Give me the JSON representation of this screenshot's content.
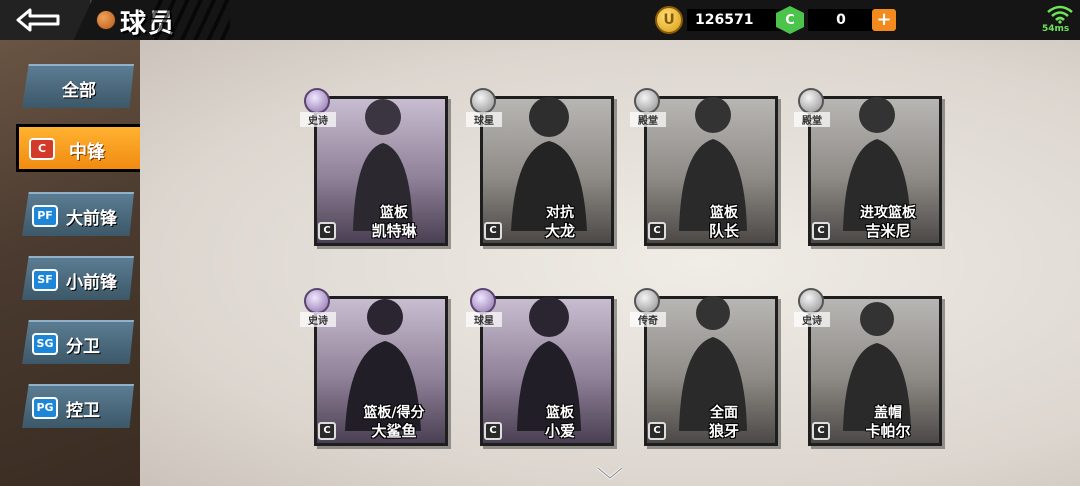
{
  "header": {
    "title": "球员",
    "coins": "126571",
    "gems": "0",
    "coin_symbol": "U",
    "gem_symbol": "C",
    "add_label": "+",
    "ping": "54ms"
  },
  "sidebar": {
    "items": [
      {
        "label": "全部",
        "badge": ""
      },
      {
        "label": "中锋",
        "badge": "C"
      },
      {
        "label": "大前锋",
        "badge": "PF"
      },
      {
        "label": "小前锋",
        "badge": "SF"
      },
      {
        "label": "分卫",
        "badge": "SG"
      },
      {
        "label": "控卫",
        "badge": "PG"
      }
    ],
    "active_index": 1
  },
  "players": [
    {
      "rank": "史诗",
      "role": "篮板",
      "name": "凯特琳",
      "pos": "C",
      "tier": "purple"
    },
    {
      "rank": "球星",
      "role": "对抗",
      "name": "大龙",
      "pos": "C",
      "tier": "gray"
    },
    {
      "rank": "殿堂",
      "role": "篮板",
      "name": "队长",
      "pos": "C",
      "tier": "gray"
    },
    {
      "rank": "殿堂",
      "role": "进攻篮板",
      "name": "吉米尼",
      "pos": "C",
      "tier": "gray"
    },
    {
      "rank": "史诗",
      "role": "篮板/得分",
      "name": "大鲨鱼",
      "pos": "C",
      "tier": "purple"
    },
    {
      "rank": "球星",
      "role": "篮板",
      "name": "小爱",
      "pos": "C",
      "tier": "purple"
    },
    {
      "rank": "传奇",
      "role": "全面",
      "name": "狼牙",
      "pos": "C",
      "tier": "gray"
    },
    {
      "rank": "史诗",
      "role": "盖帽",
      "name": "卡帕尔",
      "pos": "C",
      "tier": "gray"
    }
  ],
  "colors": {
    "active_tab": "#f39a1c",
    "nav_tab": "#4c6b80",
    "coin": "#f2b21c",
    "gem": "#4cc34a",
    "wifi": "#6fe35a"
  }
}
